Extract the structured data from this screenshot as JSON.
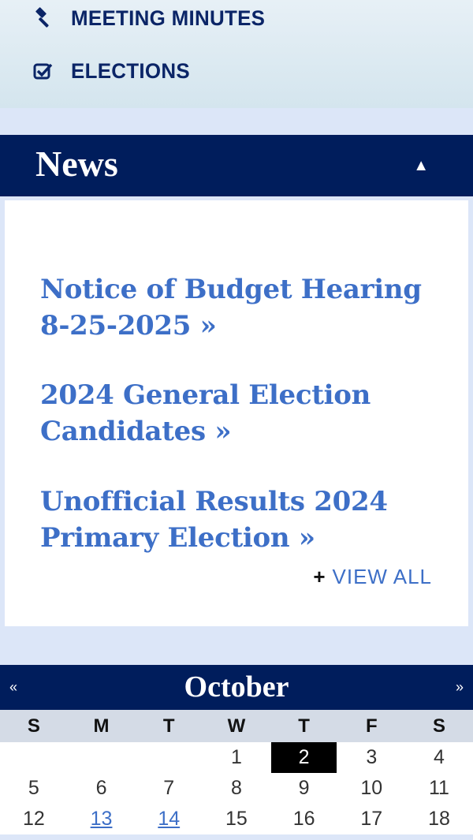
{
  "nav": {
    "items": [
      {
        "label": "MEETING MINUTES",
        "icon": "gavel-icon"
      },
      {
        "label": "ELECTIONS",
        "icon": "checkbox-icon"
      }
    ]
  },
  "news": {
    "title": "News",
    "collapse_glyph": "▲",
    "items": [
      {
        "text": "Notice of Budget Hearing 8-25-2025 »"
      },
      {
        "text": "2024 General Election Candidates  »"
      },
      {
        "text": "Unofficial Results 2024 Primary Election »"
      }
    ],
    "view_all_plus": "+",
    "view_all": "VIEW ALL"
  },
  "calendar": {
    "month": "October",
    "prev": "«",
    "next": "»",
    "days": [
      "S",
      "M",
      "T",
      "W",
      "T",
      "F",
      "S"
    ],
    "weeks": [
      [
        "",
        "",
        "",
        "1",
        "2",
        "3",
        "4"
      ],
      [
        "5",
        "6",
        "7",
        "8",
        "9",
        "10",
        "11"
      ],
      [
        "12",
        "13",
        "14",
        "15",
        "16",
        "17",
        "18"
      ]
    ],
    "today": "2",
    "event_dates": [
      "13",
      "14"
    ]
  },
  "colors": {
    "navy": "#001d5c",
    "link": "#3d6fc7",
    "nav_text": "#0b2567"
  }
}
